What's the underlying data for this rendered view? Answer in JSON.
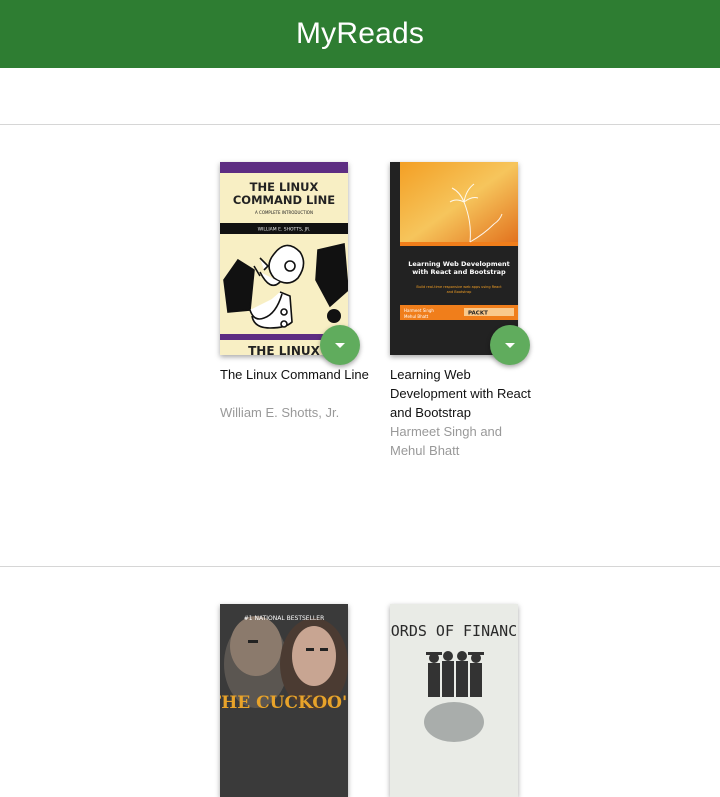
{
  "header": {
    "title": "MyReads"
  },
  "colors": {
    "header_bg": "#2e7d32",
    "changer_bg": "#60ac5d"
  },
  "shelves": [
    {
      "books": [
        {
          "title": "The Linux Command Line",
          "authors": "William E. Shotts, Jr.",
          "cover_text": {
            "title_line_1": "THE LINUX",
            "title_line_2": "COMMAND LINE",
            "subtitle": "A COMPLETE INTRODUCTION",
            "author": "WILLIAM E. SHOTTS, JR.",
            "bottom": "THE LINUX"
          },
          "changer_icon": "triangle-down-icon"
        },
        {
          "title": "Learning Web Development with React and Bootstrap",
          "authors": "Harmeet Singh and Mehul Bhatt",
          "cover_text": {
            "title": "Learning Web Development with React and Bootstrap",
            "subtitle": "Build real-time responsive web apps using React and Bootstrap",
            "publisher": "PACKT",
            "authors": "Harmeet Singh Mehul Bhatt"
          },
          "changer_icon": "triangle-down-icon"
        }
      ]
    },
    {
      "books": [
        {
          "cover_text": {
            "top": "#1 NATIONAL BESTSELLER",
            "title": "THE CUCKOO'S"
          }
        },
        {
          "cover_text": {
            "title": "LORDS OF FINANCE"
          }
        }
      ]
    }
  ]
}
